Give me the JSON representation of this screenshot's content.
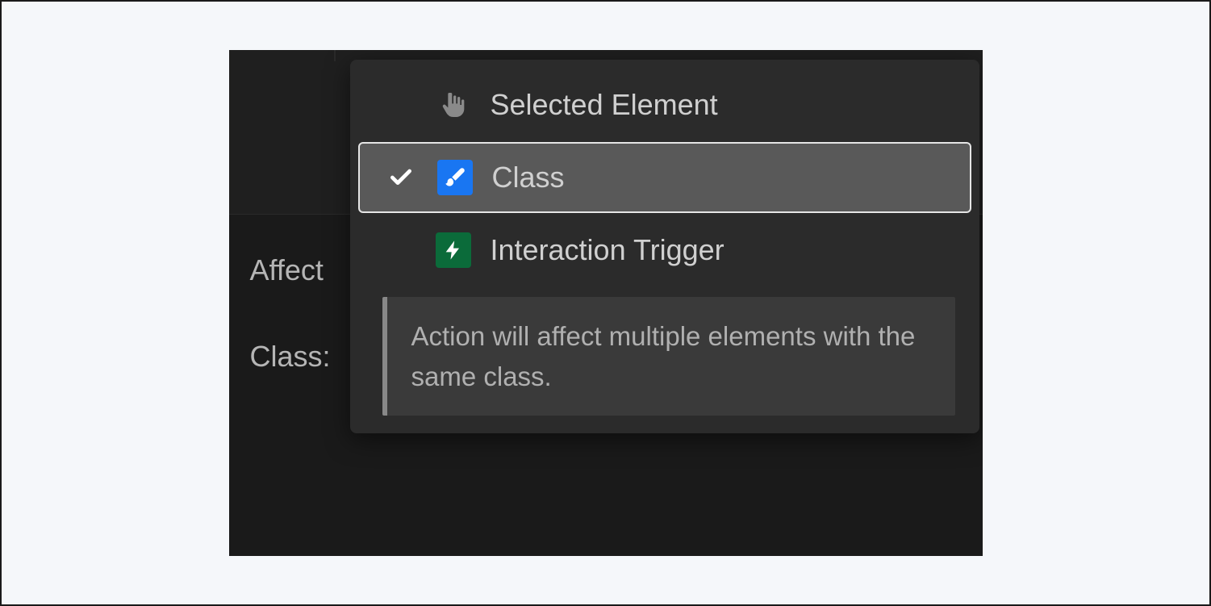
{
  "sidebar": {
    "affect_label": "Affect",
    "class_label": "Class:"
  },
  "dropdown": {
    "options": [
      {
        "label": "Selected Element"
      },
      {
        "label": "Class"
      },
      {
        "label": "Interaction Trigger"
      }
    ],
    "selected_index": 1,
    "hint_text": "Action will affect multiple elements with the same class."
  },
  "icons": {
    "cursor": "pointer-hand-icon",
    "class": "paintbrush-icon",
    "trigger": "lightning-icon",
    "check": "check-icon"
  },
  "colors": {
    "panel_bg": "#1a1a1a",
    "dropdown_bg": "#2b2b2b",
    "selected_bg": "#595959",
    "class_icon_bg": "#1976f2",
    "trigger_icon_bg": "#0b6b3a",
    "text_muted": "#b5b5b5"
  }
}
